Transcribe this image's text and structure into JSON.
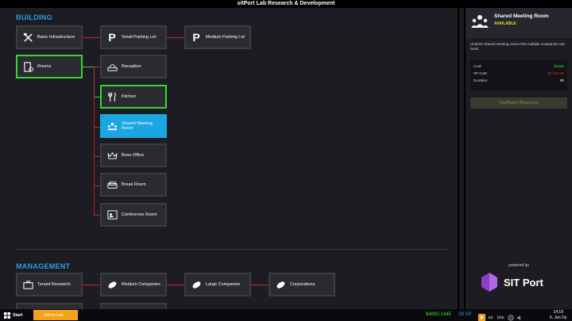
{
  "window": {
    "title": "sitPort Lab  Research & Development"
  },
  "sections": {
    "building": "BUILDING",
    "management": "MANAGEMENT"
  },
  "building_nodes": {
    "basic_infrastructure": "Basic Infrastructure",
    "small_parking_lot": "Small Parking Lot",
    "medium_parking_lot": "Medium Parking Lot",
    "rooms": "Rooms",
    "reception": "Reception",
    "kitchen": "Kitchen",
    "shared_meeting_room": "Shared Meeting Room",
    "boss_office": "Boss Office",
    "break_room": "Break Room",
    "conference_room": "Conference Room"
  },
  "management_nodes": {
    "tenant_research": "Tenant Research",
    "medium_companies": "Medium Companies",
    "large_companies": "Large Companies",
    "corporations": "Corporations"
  },
  "detail": {
    "title": "Shared Meeting Room",
    "status": "AVAILABLE",
    "description": "Unlocks shared meeting rooms that multiple companies can book.",
    "cost_label": "Cost:",
    "cost_value": "$1000",
    "xp_label": "XP Cost:",
    "xp_value": "50 / 29 XP",
    "duration_label": "Duration:",
    "duration_value": "6h",
    "button": "Insufficient Resources",
    "powered_by": "powered by",
    "logo_text": "SIT Port"
  },
  "taskbar": {
    "start": "Start",
    "app": "sitPort Lab",
    "money": "$4800.1445",
    "xp": "29 XP",
    "time": "14:19",
    "date": "6. Jan Oy"
  },
  "colors": {
    "accent_blue": "#2b9fe0",
    "selected_green": "#38d432",
    "line_red": "#c1262a",
    "taskbar_orange": "#f5a21b"
  }
}
